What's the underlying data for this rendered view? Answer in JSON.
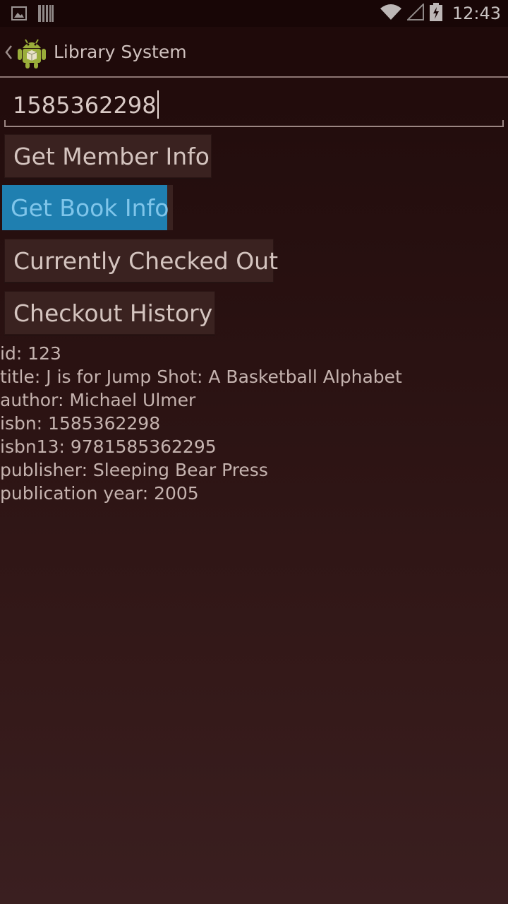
{
  "status_bar": {
    "time": "12:43",
    "icons": [
      "image-icon",
      "barcode-icon",
      "wifi-icon",
      "signal-icon",
      "battery-charging-icon"
    ]
  },
  "action_bar": {
    "title": "Library System",
    "icons": [
      "back-chevron-icon",
      "android-app-icon"
    ]
  },
  "search": {
    "value": "1585362298"
  },
  "buttons": {
    "member_info": "Get Member Info",
    "book_info": "Get Book Info",
    "checked_out": "Currently Checked Out",
    "history": "Checkout History"
  },
  "book": {
    "lines": [
      "id: 123",
      "title: J is for Jump Shot: A Basketball Alphabet",
      "author: Michael Ulmer",
      "isbn: 1585362298",
      "isbn13: 9781585362295",
      "publisher: Sleeping Bear Press",
      "publication year: 2005"
    ]
  },
  "colors": {
    "background": "#2a1212",
    "pressed_button": "#1f7fb0",
    "button": "#3a2220",
    "text": "#c5b3af"
  }
}
